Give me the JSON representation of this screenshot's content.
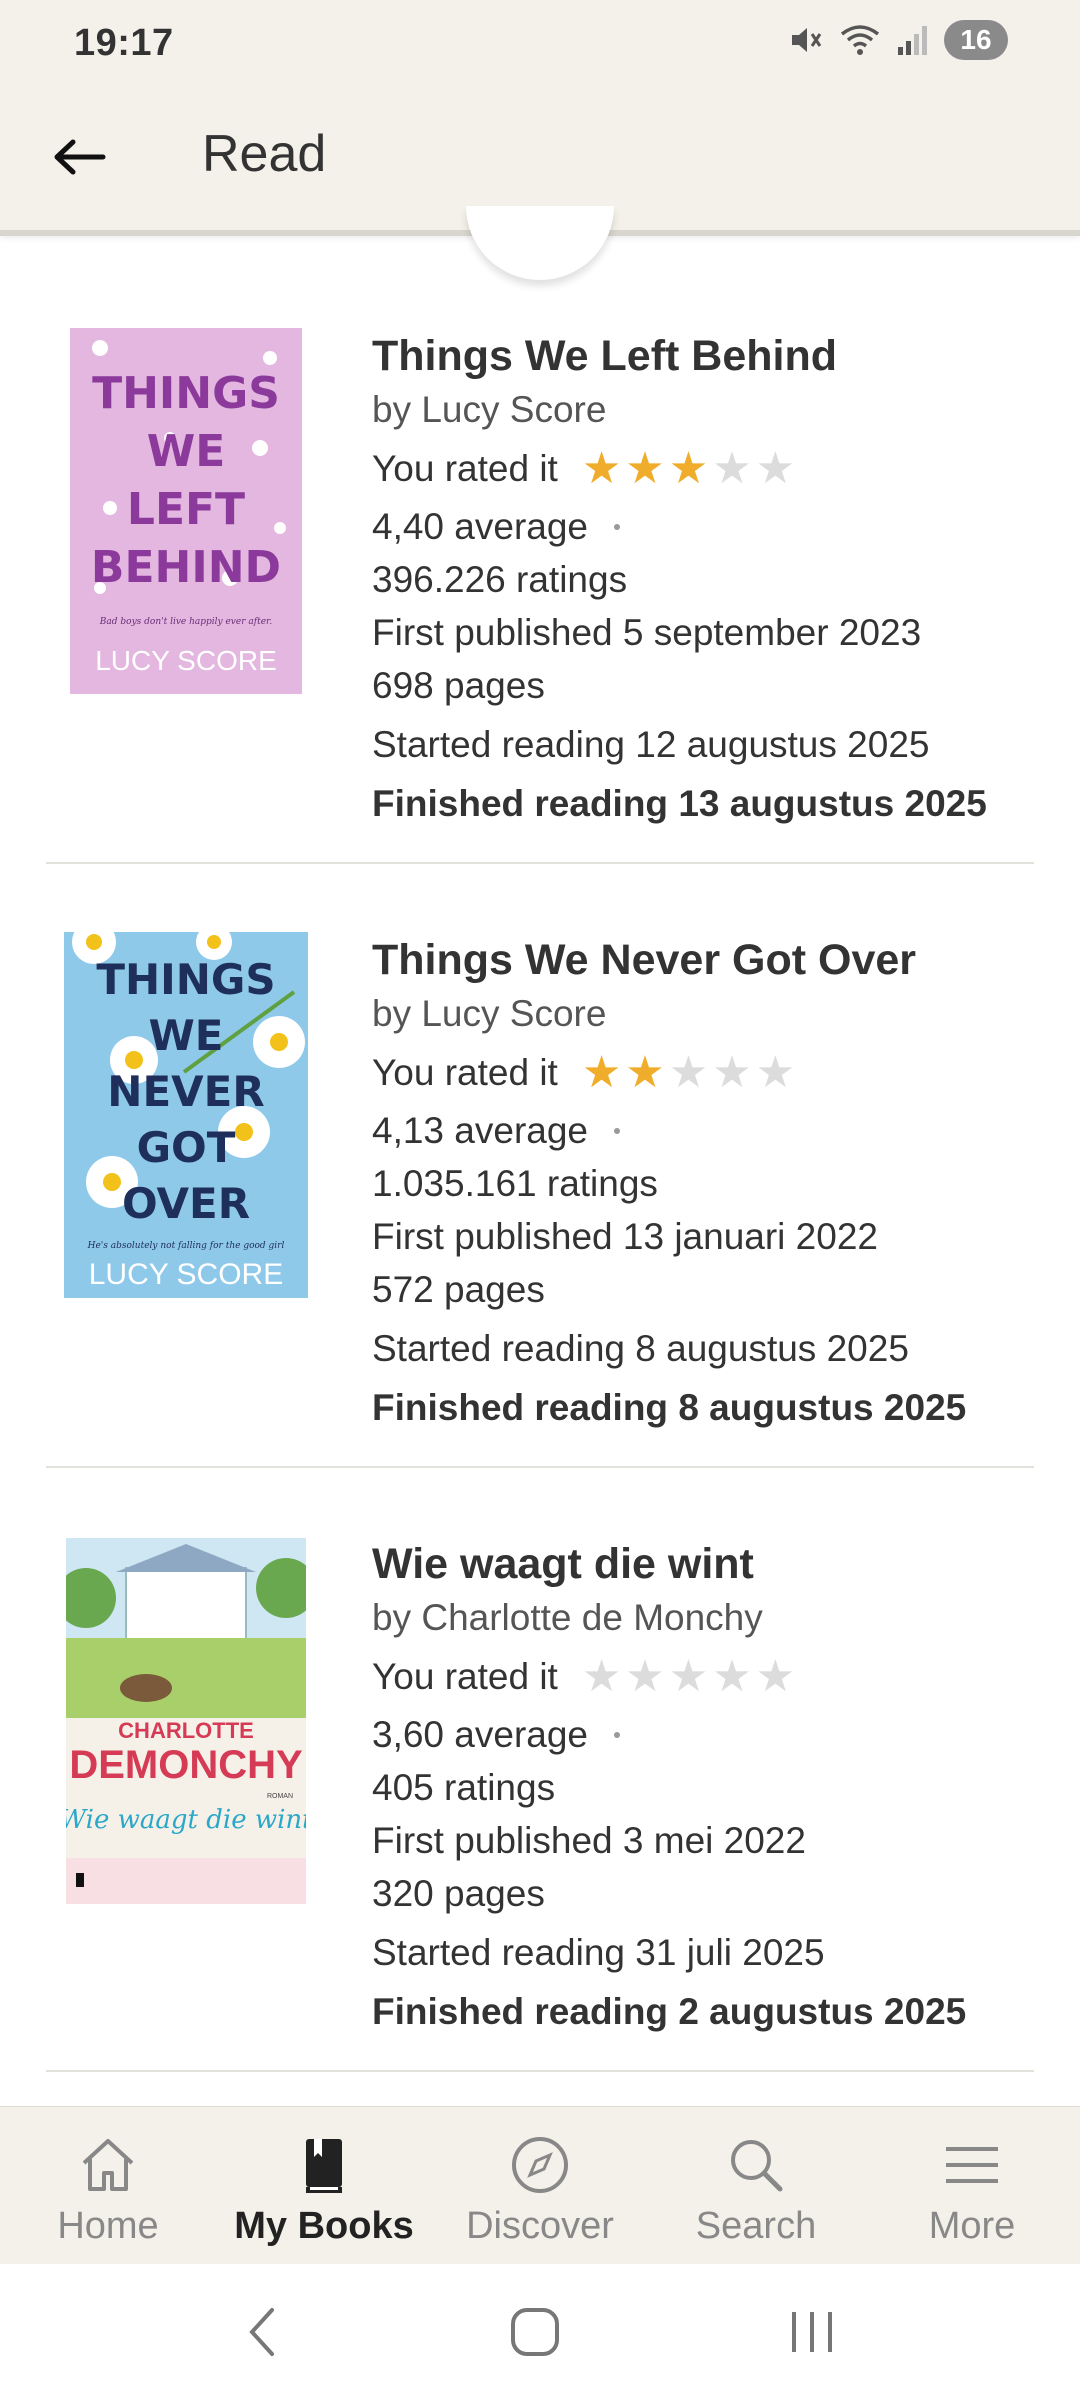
{
  "status_bar": {
    "time": "19:17",
    "battery": "16",
    "icons": [
      "mute-icon",
      "wifi-icon",
      "signal-icon",
      "battery-icon"
    ]
  },
  "app_bar": {
    "title": "Read",
    "back_icon": "arrow-left-icon"
  },
  "books": [
    {
      "title": "Things We Left Behind",
      "author": "by Lucy Score",
      "rating_label": "You rated it",
      "user_rating": 3,
      "average": "4,40 average",
      "ratings": "396.226 ratings",
      "first_published": "First published 5 september 2023",
      "pages": "698 pages",
      "started": "Started reading 12 augustus 2025",
      "finished": "Finished reading 13 augustus 2025",
      "cover": {
        "lines": [
          "THINGS",
          "WE",
          "LEFT",
          "BEHIND"
        ],
        "tagline": "Bad boys don't live happily ever after.",
        "author": "LUCY SCORE",
        "bg": "#e3b7df",
        "text_color": "#8b3a9c"
      }
    },
    {
      "title": "Things We Never Got Over",
      "author": "by Lucy Score",
      "rating_label": "You rated it",
      "user_rating": 2,
      "average": "4,13 average",
      "ratings": "1.035.161 ratings",
      "first_published": "First published 13 januari 2022",
      "pages": "572 pages",
      "started": "Started reading 8 augustus 2025",
      "finished": "Finished reading 8 augustus 2025",
      "cover": {
        "lines": [
          "THINGS",
          "WE",
          "NEVER",
          "GOT",
          "OVER"
        ],
        "tagline": "He's absolutely not falling for the good girl",
        "author": "LUCY SCORE",
        "bg": "#8fc9ea",
        "text_color": "#1f2f5c"
      }
    },
    {
      "title": "Wie waagt die wint",
      "author": "by Charlotte de Monchy",
      "rating_label": "You rated it",
      "user_rating": 0,
      "average": "3,60 average",
      "ratings": "405 ratings",
      "first_published": "First published 3 mei 2022",
      "pages": "320 pages",
      "started": "Started reading 31 juli 2025",
      "finished": "Finished reading 2 augustus 2025",
      "cover": {
        "top_name": "CHARLOTTE",
        "bottom_name": "DEMONCHY",
        "script_title": "Wie waagt die wint",
        "badge": "ROMAN",
        "bg": "#f6f1e8",
        "text_color": "#d63b55",
        "script_color": "#2aa7c9"
      }
    }
  ],
  "bottom_nav": {
    "items": [
      {
        "label": "Home",
        "icon": "home-icon",
        "active": false
      },
      {
        "label": "My Books",
        "icon": "book-icon",
        "active": true
      },
      {
        "label": "Discover",
        "icon": "compass-icon",
        "active": false
      },
      {
        "label": "Search",
        "icon": "search-icon",
        "active": false
      },
      {
        "label": "More",
        "icon": "menu-icon",
        "active": false
      }
    ]
  },
  "system_nav": {
    "buttons": [
      "system-back-icon",
      "system-home-icon",
      "system-recents-icon"
    ]
  },
  "colors": {
    "background": "#ffffff",
    "bar": "#f4f1ea",
    "star_on": "#f0ad2b",
    "star_off": "#dcdcdc"
  }
}
